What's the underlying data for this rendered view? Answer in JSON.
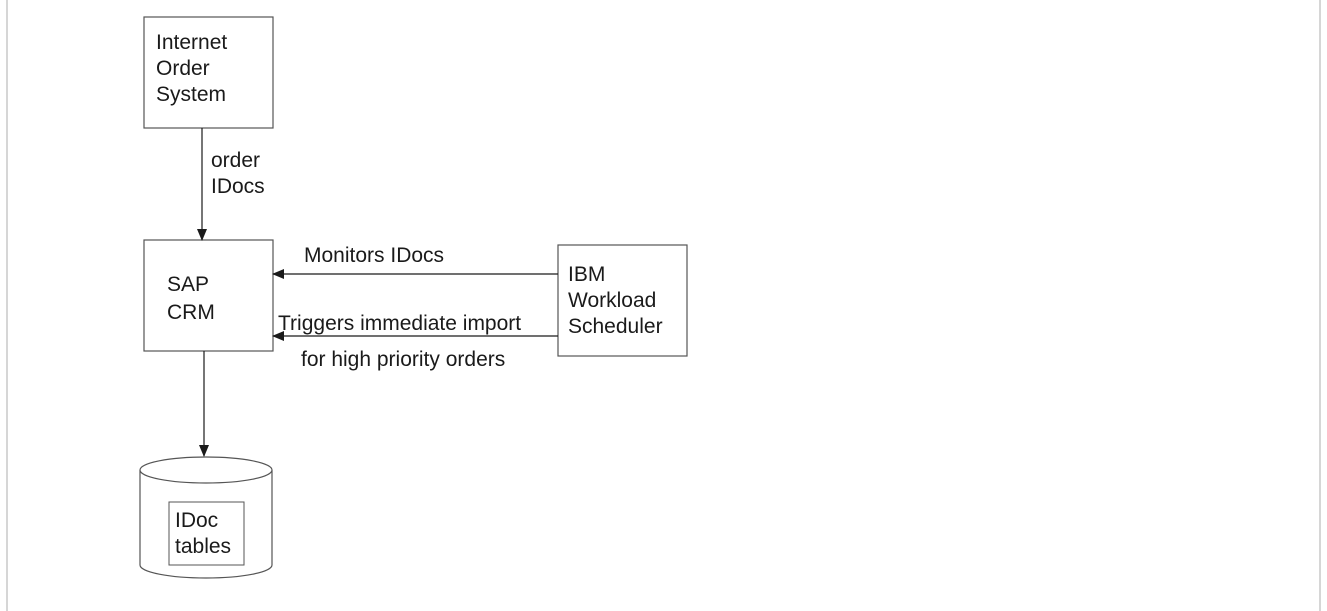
{
  "nodes": {
    "internet_order_system": {
      "lines": [
        "Internet",
        "Order",
        "System"
      ]
    },
    "sap_crm": {
      "lines": [
        "SAP",
        "CRM"
      ]
    },
    "workload_scheduler": {
      "lines": [
        "IBM",
        "Workload",
        "Scheduler"
      ]
    },
    "idoc_tables": {
      "lines": [
        "IDoc",
        "tables"
      ]
    }
  },
  "edges": {
    "order_idocs": {
      "lines": [
        "order",
        "IDocs"
      ]
    },
    "monitors": {
      "label": "Monitors IDocs"
    },
    "triggers": {
      "lines": [
        "Triggers immediate import",
        "for high priority orders"
      ]
    }
  },
  "colors": {
    "line": "#1a1a1a",
    "border": "#555555",
    "frame": "#d6d6d6"
  }
}
